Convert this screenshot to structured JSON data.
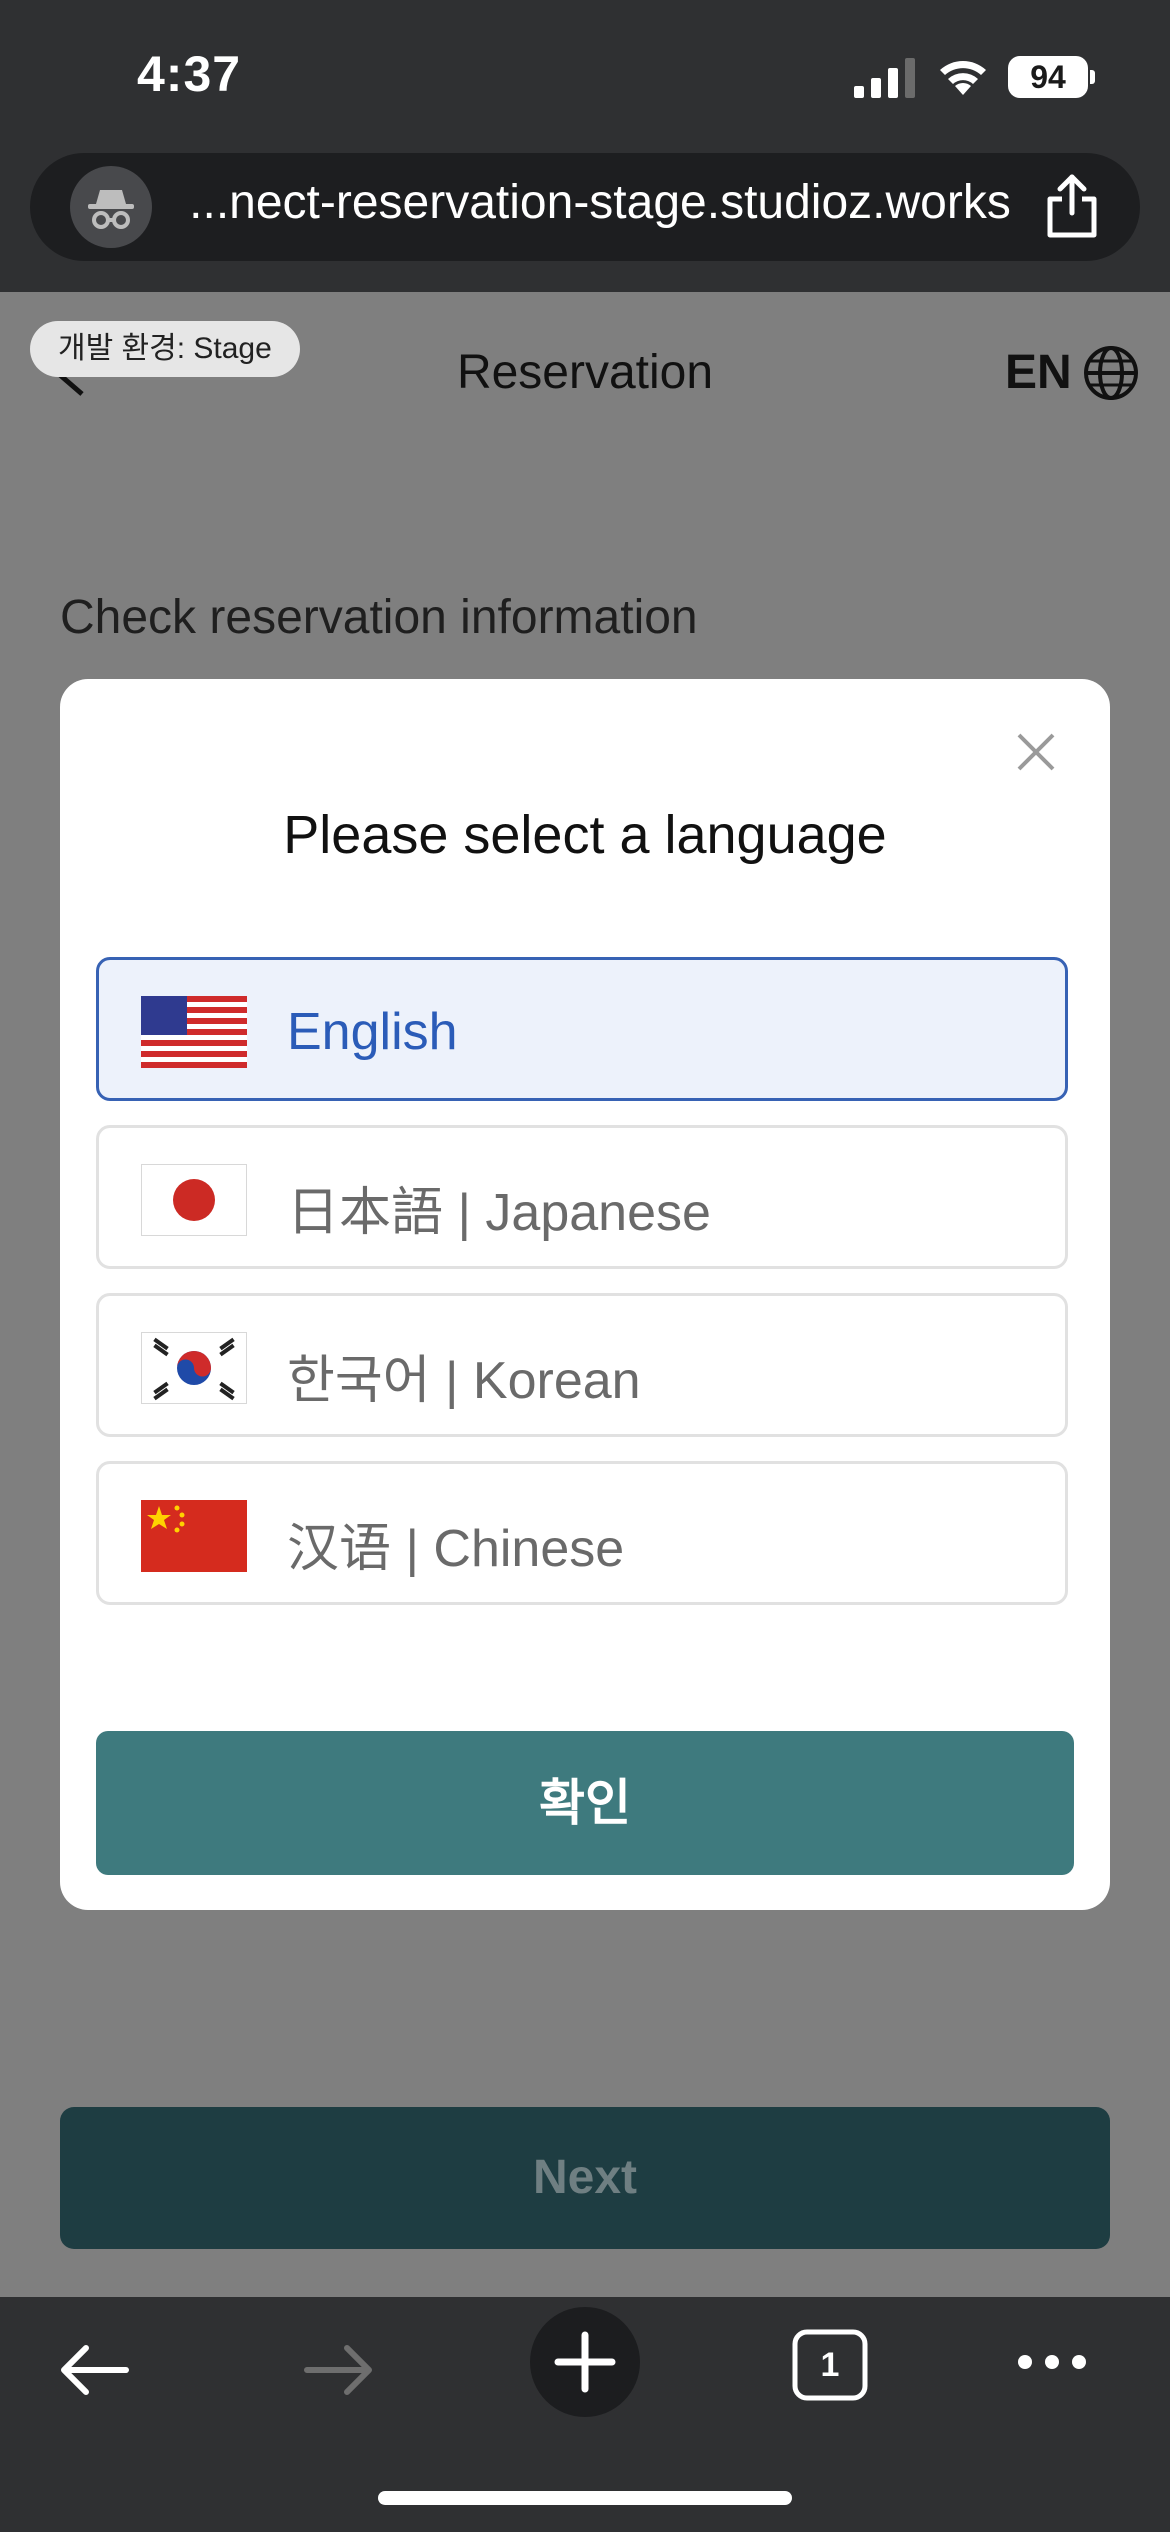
{
  "status_bar": {
    "time": "4:37",
    "battery": "94"
  },
  "browser": {
    "url": "...nect-reservation-stage.studioz.works"
  },
  "header": {
    "env_badge": "개발 환경: Stage",
    "title": "Reservation",
    "language_code": "EN"
  },
  "main": {
    "section_label": "Check reservation information",
    "next_label": "Next"
  },
  "modal": {
    "title": "Please select a language",
    "options": [
      {
        "label": "English",
        "flag": "us-flag-icon",
        "selected": true
      },
      {
        "label": "日本語 | Japanese",
        "flag": "japan-flag-icon",
        "selected": false
      },
      {
        "label": "한국어 | Korean",
        "flag": "korea-flag-icon",
        "selected": false
      },
      {
        "label": "汉语 | Chinese",
        "flag": "china-flag-icon",
        "selected": false
      }
    ],
    "confirm_label": "확인"
  },
  "toolbar": {
    "tab_count": "1"
  },
  "colors": {
    "accent": "#3e7a7e",
    "selected_border": "#3762b4",
    "selected_bg": "#edf2fb",
    "next_bg": "#1e3d42"
  }
}
